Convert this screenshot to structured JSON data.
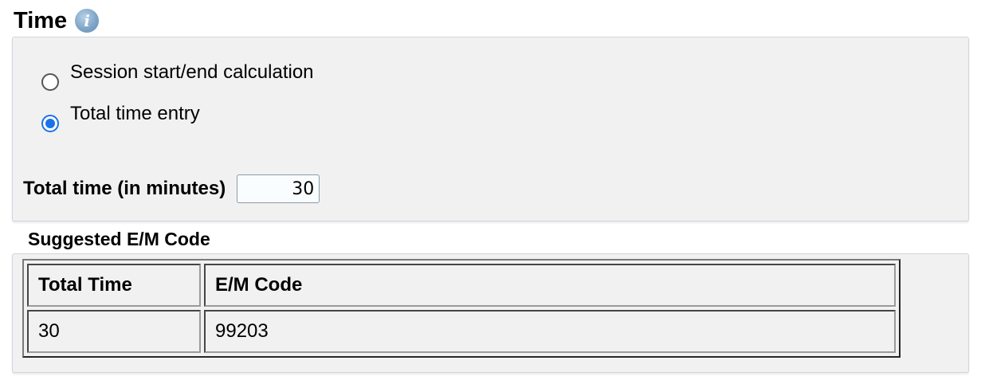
{
  "section": {
    "title": "Time",
    "info_icon": "info-icon"
  },
  "time_mode": {
    "options": [
      {
        "label": "Session start/end calculation",
        "checked": false
      },
      {
        "label": "Total time entry",
        "checked": true
      }
    ]
  },
  "total_time": {
    "label": "Total time (in minutes)",
    "value": "30"
  },
  "suggested": {
    "title": "Suggested E/M Code",
    "columns": [
      "Total Time",
      "E/M Code"
    ],
    "rows": [
      [
        "30",
        "99203"
      ]
    ]
  },
  "colors": {
    "panel_bg": "#f1f1f1",
    "accent": "#1a73e8"
  }
}
